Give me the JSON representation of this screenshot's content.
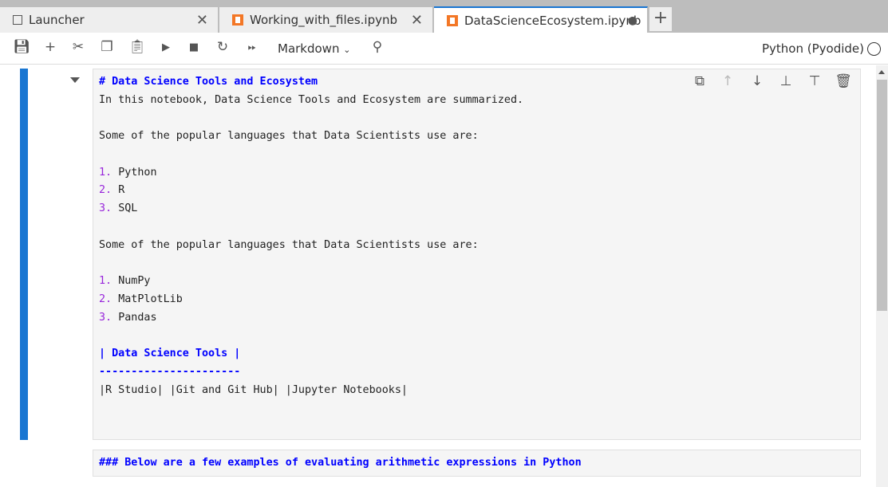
{
  "tabs": [
    {
      "label": "Launcher",
      "icon": "launcher-icon"
    },
    {
      "label": "Working_with_files.ipynb",
      "icon": "notebook-icon"
    },
    {
      "label": "DataScienceEcosystem.ipynb",
      "icon": "notebook-icon",
      "active": true,
      "unsaved": true
    }
  ],
  "toolbar": {
    "cell_type": "Markdown",
    "kernel": "Python (Pyodide)",
    "icons": [
      "save-icon",
      "add-icon",
      "cut-icon",
      "copy-icon",
      "paste-icon",
      "run-icon",
      "stop-icon",
      "restart-icon",
      "run-all-icon",
      "pin-icon"
    ]
  },
  "cell1": {
    "lines": [
      "# Data Science Tools and Ecosystem",
      "In this notebook, Data Science Tools and Ecosystem are summarized.",
      "Some of the popular languages that Data Scientists use are:",
      "Python",
      "R",
      "SQL",
      "Some of the popular languages that Data Scientists use are:",
      "NumPy",
      "MatPlotLib",
      "Pandas",
      "| Data Science Tools |",
      "----------------------",
      "|R Studio| |Git and Git Hub| |Jupyter Notebooks|"
    ],
    "nums": [
      "1.",
      "2.",
      "3."
    ]
  },
  "cell2": {
    "text": "### Below are a few examples of evaluating arithmetic expressions in Python"
  },
  "colors": {
    "accent": "#1976d2",
    "heading": "#0000ff",
    "list_number": "#9826db",
    "notebook": "#f37726"
  }
}
